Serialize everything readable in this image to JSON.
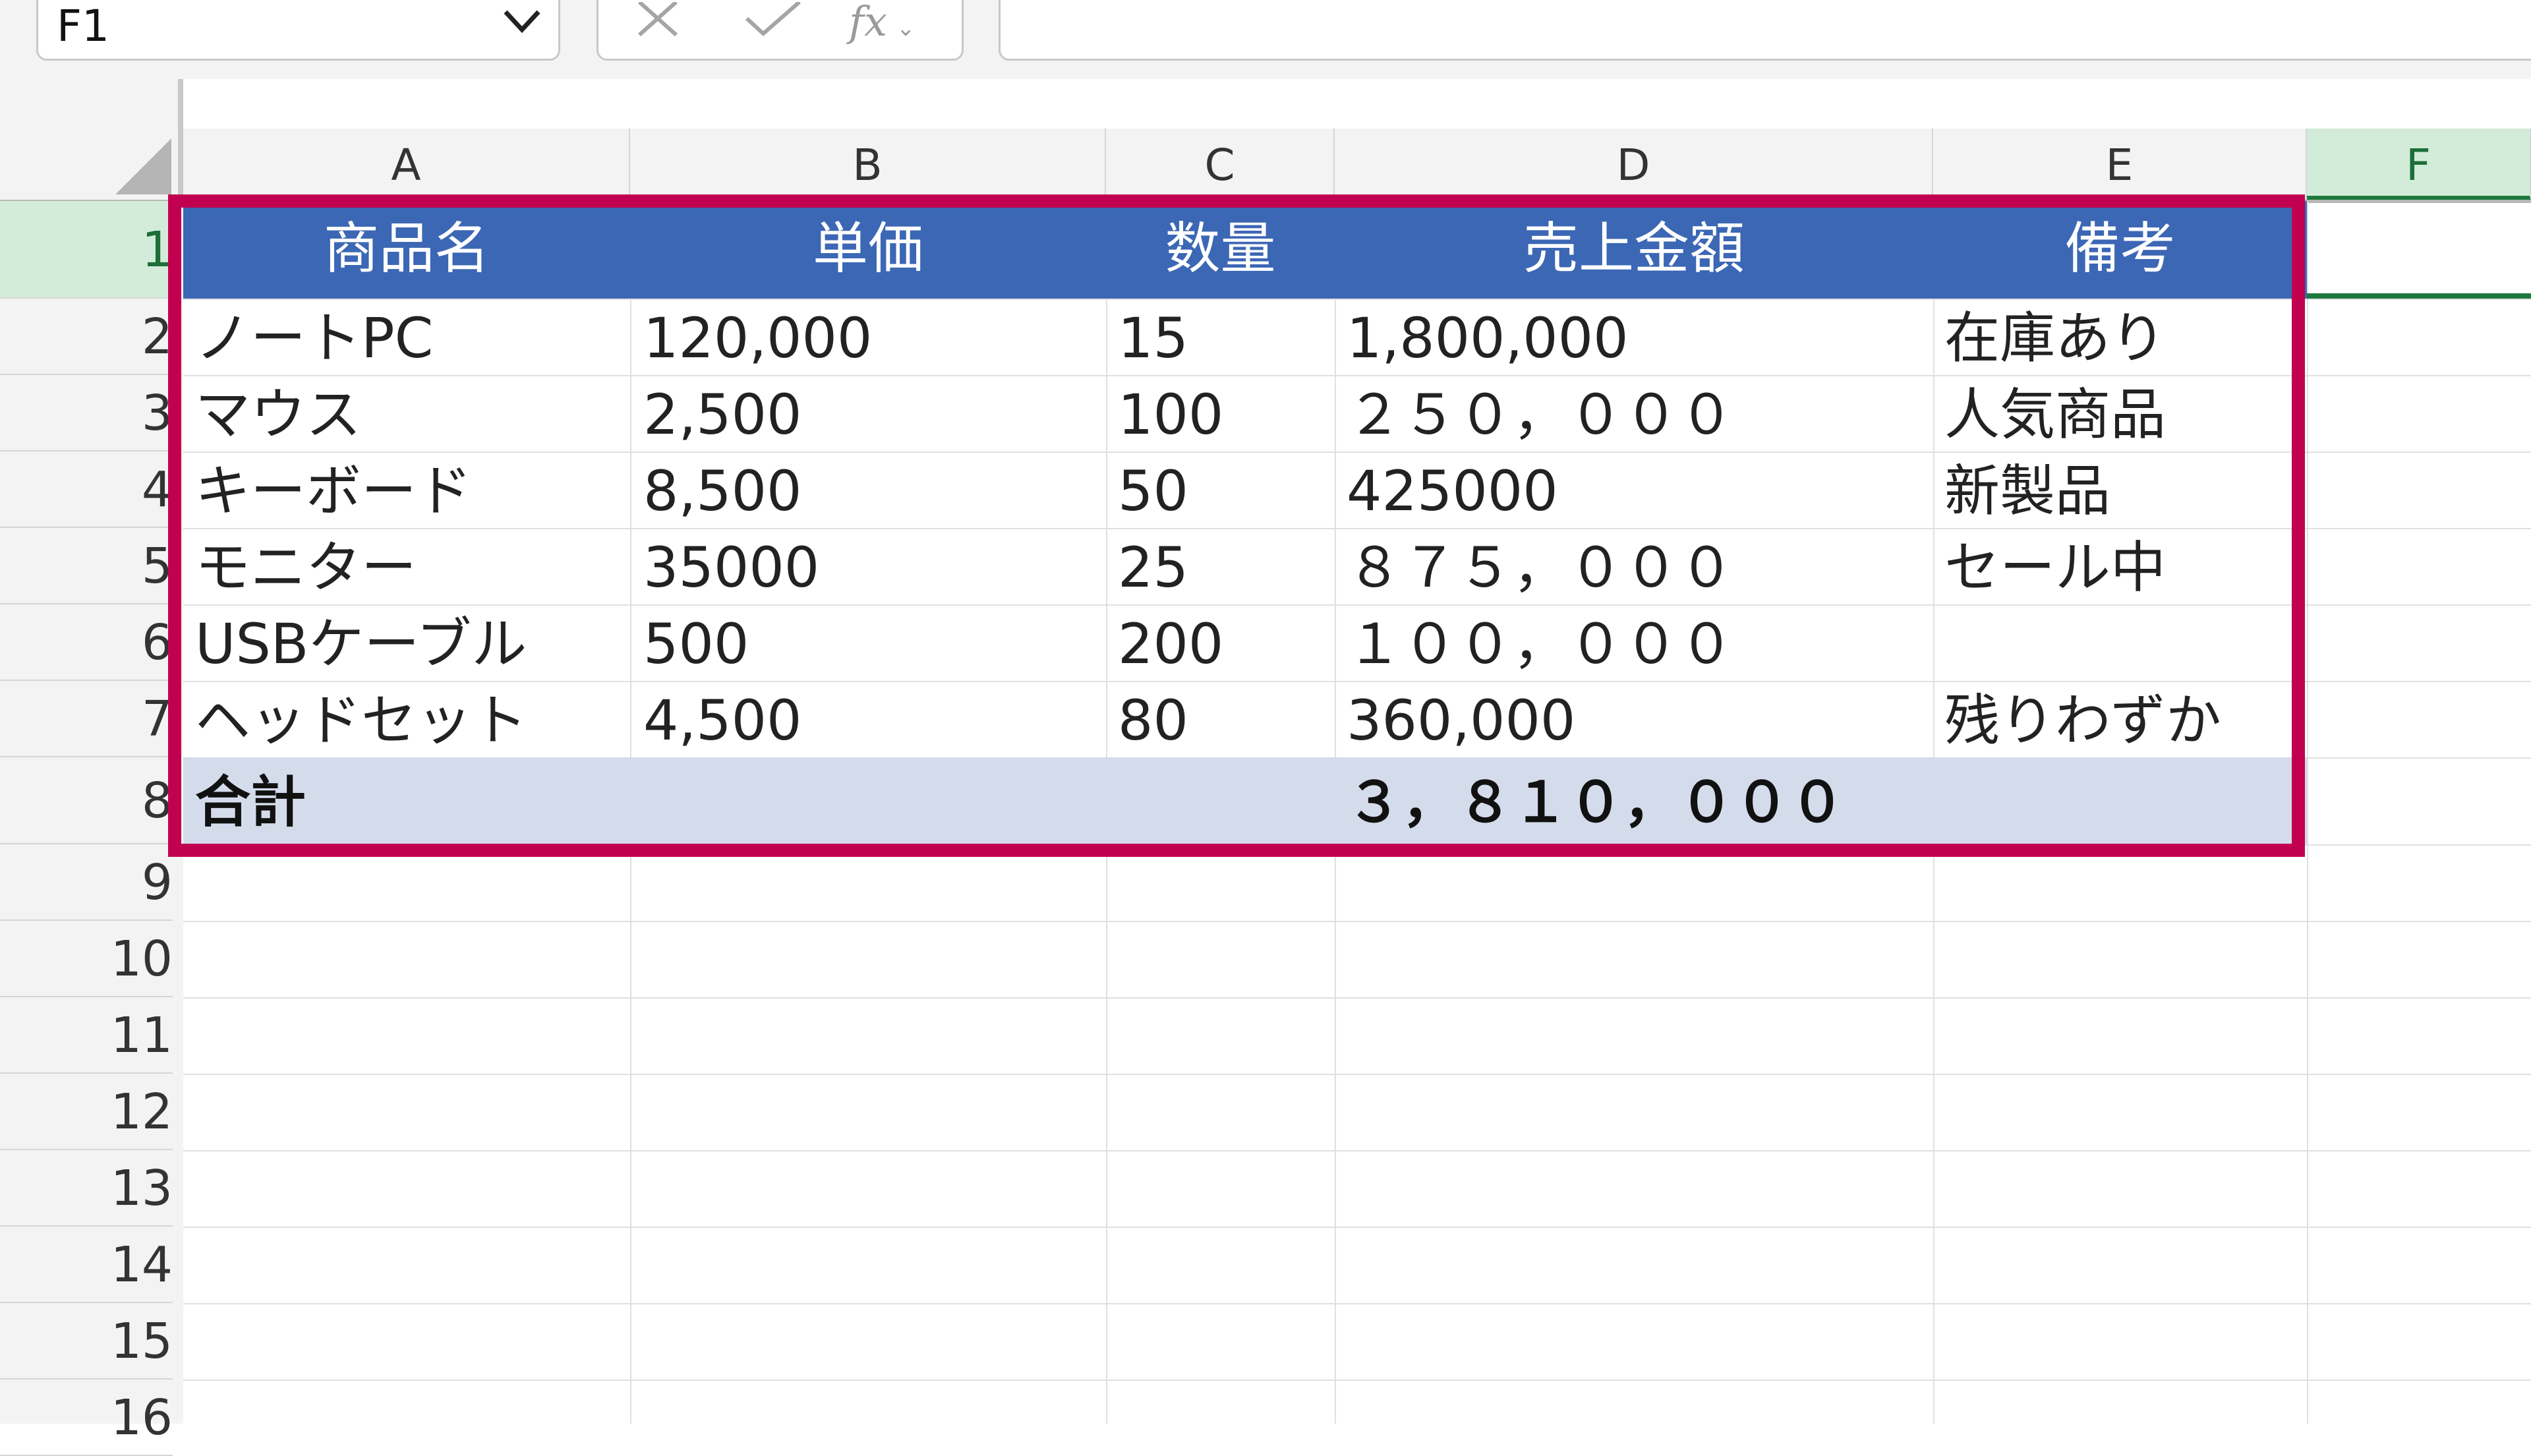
{
  "formula_bar": {
    "name_box": "F1",
    "fx_label": "fx",
    "formula": ""
  },
  "columns": [
    "A",
    "B",
    "C",
    "D",
    "E",
    "F"
  ],
  "selected_column": "F",
  "rows": [
    "1",
    "2",
    "3",
    "4",
    "5",
    "6",
    "7",
    "8",
    "9",
    "10",
    "11",
    "12",
    "13",
    "14",
    "15",
    "16"
  ],
  "selected_row": "1",
  "table": {
    "headers": [
      "商品名",
      "単価",
      "数量",
      "売上金額",
      "備考"
    ],
    "rows": [
      [
        "ノートPC",
        "120,000",
        "15",
        "1,800,000",
        "在庫あり"
      ],
      [
        "マウス",
        "2,500",
        "100",
        "２５０，０００",
        "人気商品"
      ],
      [
        "キーボード",
        "8,500",
        "50",
        "425000",
        "新製品"
      ],
      [
        "モニター",
        "35000",
        "25",
        "８７５，０００",
        "セール中"
      ],
      [
        "USBケーブル",
        "500",
        "200",
        "１００，０００",
        ""
      ],
      [
        "ヘッドセット",
        "4,500",
        "80",
        "360,000",
        "残りわずか"
      ]
    ],
    "total_label": "合計",
    "total_value": "３，８１０，０００"
  },
  "colors": {
    "header_fill": "#3c67b5",
    "total_fill": "#d4dcec",
    "highlight_border": "#c20050",
    "selection_green": "#1e7a3c"
  }
}
